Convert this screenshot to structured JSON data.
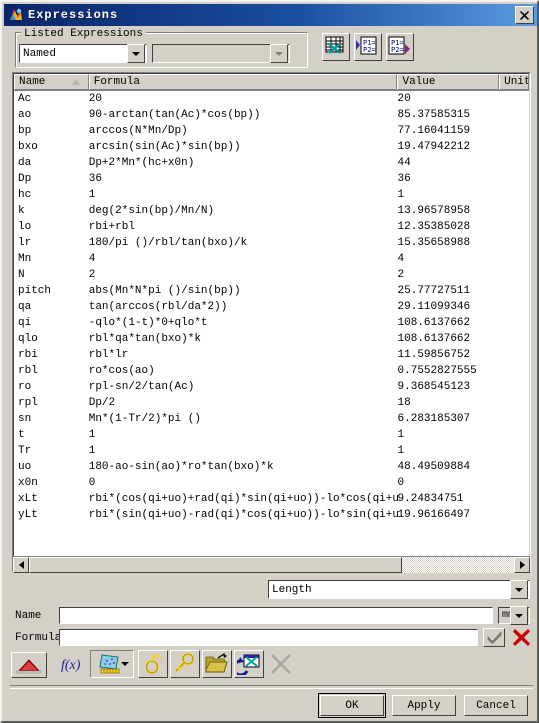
{
  "window": {
    "title": "Expressions",
    "icon": "ug-app-icon",
    "close_label": "✕"
  },
  "listed_expressions": {
    "group_label": "Listed Expressions",
    "filter_value": "Named",
    "filter_placeholder": "",
    "secondary_value": "",
    "secondary_placeholder": ""
  },
  "top_toolbar": [
    {
      "name": "create-multiple-expressions-icon",
      "tooltip": "Create Multiple Expressions"
    },
    {
      "name": "import-expressions-icon",
      "tooltip": "Import Expressions from File"
    },
    {
      "name": "export-expressions-icon",
      "tooltip": "Export Expressions to File"
    }
  ],
  "table": {
    "columns": [
      {
        "key": "name",
        "label": "Name",
        "sorted": true
      },
      {
        "key": "formula",
        "label": "Formula",
        "sorted": false
      },
      {
        "key": "value",
        "label": "Value",
        "sorted": false
      },
      {
        "key": "units",
        "label": "Units",
        "sorted": false
      }
    ],
    "rows": [
      {
        "name": "Ac",
        "formula": "20",
        "value": "20",
        "units": ""
      },
      {
        "name": "ao",
        "formula": "90-arctan(tan(Ac)*cos(bp))",
        "value": "85.37585315",
        "units": ""
      },
      {
        "name": "bp",
        "formula": "arccos(N*Mn/Dp)",
        "value": "77.16041159",
        "units": ""
      },
      {
        "name": "bxo",
        "formula": "arcsin(sin(Ac)*sin(bp))",
        "value": "19.47942212",
        "units": ""
      },
      {
        "name": "da",
        "formula": "Dp+2*Mn*(hc+x0n)",
        "value": "44",
        "units": ""
      },
      {
        "name": "Dp",
        "formula": "36",
        "value": "36",
        "units": ""
      },
      {
        "name": "hc",
        "formula": "1",
        "value": "1",
        "units": ""
      },
      {
        "name": "k",
        "formula": "deg(2*sin(bp)/Mn/N)",
        "value": "13.96578958",
        "units": ""
      },
      {
        "name": "lo",
        "formula": "rbi+rbl",
        "value": "12.35385028",
        "units": ""
      },
      {
        "name": "lr",
        "formula": "180/pi ()/rbl/tan(bxo)/k",
        "value": "15.35658988",
        "units": ""
      },
      {
        "name": "Mn",
        "formula": "4",
        "value": "4",
        "units": ""
      },
      {
        "name": "N",
        "formula": "2",
        "value": "2",
        "units": ""
      },
      {
        "name": "pitch",
        "formula": "abs(Mn*N*pi ()/sin(bp))",
        "value": "25.77727511",
        "units": ""
      },
      {
        "name": "qa",
        "formula": "tan(arccos(rbl/da*2))",
        "value": "29.11099346",
        "units": ""
      },
      {
        "name": "qi",
        "formula": "-qlo*(1-t)*0+qlo*t",
        "value": "108.6137662",
        "units": ""
      },
      {
        "name": "qlo",
        "formula": "rbl*qa*tan(bxo)*k",
        "value": "108.6137662",
        "units": ""
      },
      {
        "name": "rbi",
        "formula": "rbl*lr",
        "value": "11.59856752",
        "units": ""
      },
      {
        "name": "rbl",
        "formula": "ro*cos(ao)",
        "value": "0.7552827555",
        "units": ""
      },
      {
        "name": "ro",
        "formula": "rpl-sn/2/tan(Ac)",
        "value": "9.368545123",
        "units": ""
      },
      {
        "name": "rpl",
        "formula": "Dp/2",
        "value": "18",
        "units": ""
      },
      {
        "name": "sn",
        "formula": "Mn*(1-Tr/2)*pi ()",
        "value": "6.283185307",
        "units": ""
      },
      {
        "name": "t",
        "formula": "1",
        "value": "1",
        "units": ""
      },
      {
        "name": "Tr",
        "formula": "1",
        "value": "1",
        "units": ""
      },
      {
        "name": "uo",
        "formula": "180-ao-sin(ao)*ro*tan(bxo)*k",
        "value": "48.49509884",
        "units": ""
      },
      {
        "name": "x0n",
        "formula": "0",
        "value": "0",
        "units": ""
      },
      {
        "name": "xLt",
        "formula": "rbi*(cos(qi+uo)+rad(qi)*sin(qi+uo))-lo*cos(qi+uo)",
        "value": "9.24834751",
        "units": ""
      },
      {
        "name": "yLt",
        "formula": "rbi*(sin(qi+uo)-rad(qi)*cos(qi+uo))-lo*sin(qi+uo)",
        "value": "19.96166497",
        "units": ""
      }
    ]
  },
  "dimensionality": {
    "value": "Length",
    "options": [
      "Length"
    ]
  },
  "name_field": {
    "label": "Name",
    "value": "",
    "placeholder": ""
  },
  "unit_field": {
    "value": "mm"
  },
  "formula_field": {
    "label": "Formula",
    "value": "",
    "placeholder": ""
  },
  "accept_button": {
    "name": "accept-check",
    "label": "✔"
  },
  "reject_button": {
    "name": "reject-x",
    "label": "✖"
  },
  "bottom_toolbar": [
    {
      "name": "measurement-icon",
      "tooltip": "Measurement"
    },
    {
      "name": "function-fx-icon",
      "tooltip": "Functions"
    },
    {
      "name": "create-measurement-icon",
      "tooltip": "Create Measurement",
      "has_dropdown": true
    },
    {
      "name": "create-interpart-icon",
      "tooltip": "Create Interpart Reference"
    },
    {
      "name": "edit-interpart-icon",
      "tooltip": "Edit Interpart Reference"
    },
    {
      "name": "open-file-icon",
      "tooltip": "Open Expression File"
    },
    {
      "name": "update-refresh-icon",
      "tooltip": "Update for External Change"
    },
    {
      "name": "delete-x-icon",
      "tooltip": "Delete Expression",
      "disabled": true
    }
  ],
  "dialog_buttons": {
    "ok": "OK",
    "apply": "Apply",
    "cancel": "Cancel"
  },
  "colors": {
    "titlebar_start": "#0a246a",
    "titlebar_end": "#5a9ae0",
    "face": "#d4d0c8",
    "field_bg": "#ffffff",
    "accent_red": "#cc0000",
    "accent_blue": "#000080",
    "icon_yellow": "#f2d22e"
  }
}
